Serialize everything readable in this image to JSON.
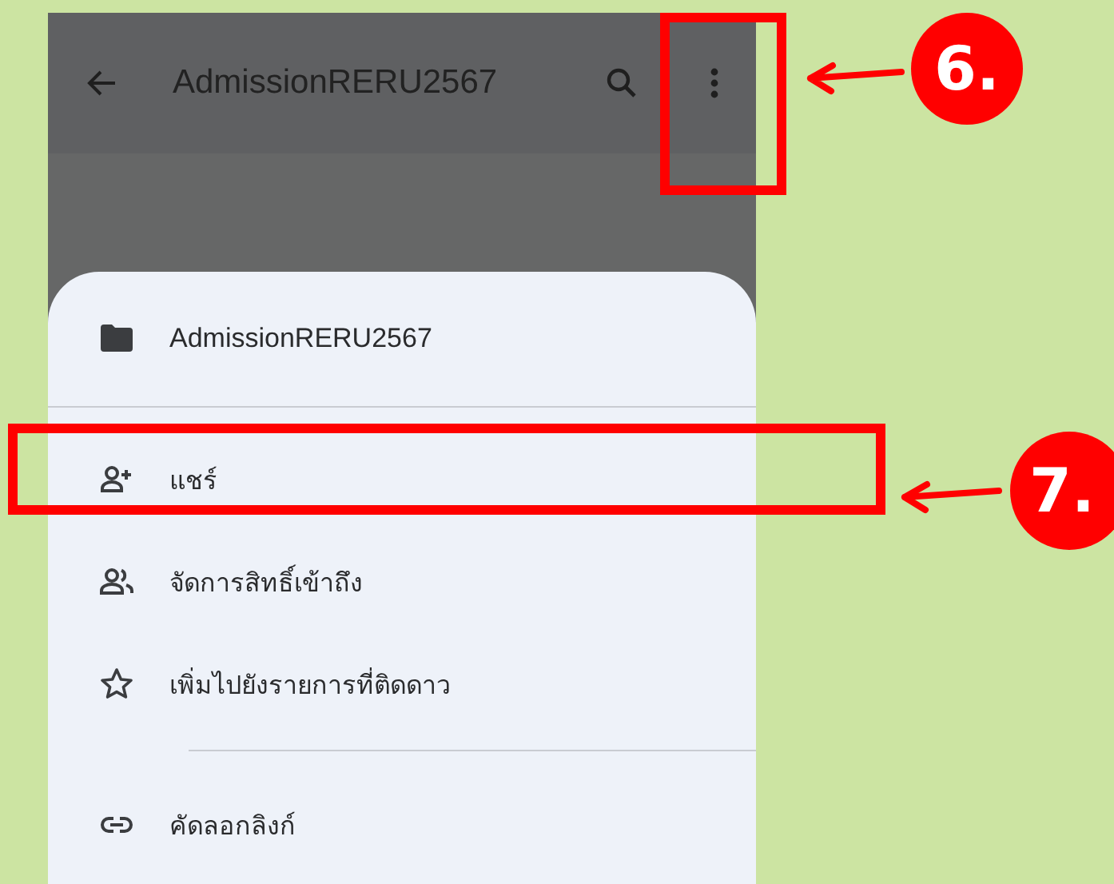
{
  "app_bar": {
    "title": "AdmissionRERU2567"
  },
  "sheet": {
    "items": [
      {
        "kind": "header",
        "label": "AdmissionRERU2567"
      },
      {
        "kind": "divider"
      },
      {
        "kind": "share",
        "label": "แชร์"
      },
      {
        "kind": "manage-access",
        "label": "จัดการสิทธิ์เข้าถึง"
      },
      {
        "kind": "star",
        "label": "เพิ่มไปยังรายการที่ติดดาว"
      },
      {
        "kind": "divider"
      },
      {
        "kind": "link",
        "label": "คัดลอกลิงก์"
      }
    ]
  },
  "annotations": [
    {
      "kind": "more",
      "label": "6."
    },
    {
      "kind": "row",
      "label": "7."
    }
  ]
}
